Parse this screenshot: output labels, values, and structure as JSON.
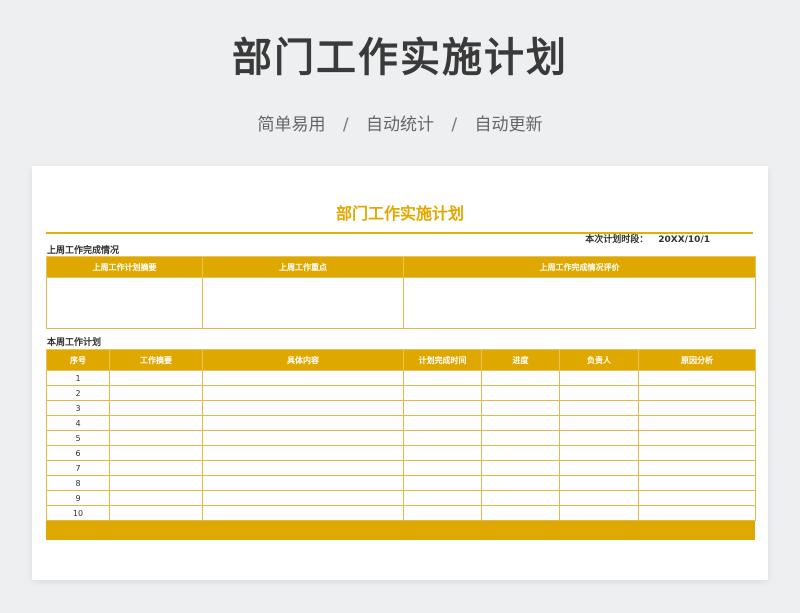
{
  "header": {
    "title": "部门工作实施计划",
    "subtitle_items": [
      "简单易用",
      "自动统计",
      "自动更新"
    ],
    "separator": "/"
  },
  "sheet": {
    "title": "部门工作实施计划",
    "plan_date_label": "本次计划时段：",
    "plan_date_value": "20XX/10/1",
    "last_week": {
      "section_label": "上周工作完成情况",
      "columns": [
        "上周工作计划摘要",
        "上周工作重点",
        "上周工作完成情况评价"
      ]
    },
    "this_week": {
      "section_label": "本周工作计划",
      "columns": [
        "序号",
        "工作摘要",
        "具体内容",
        "计划完成时间",
        "进度",
        "负责人",
        "原因分析"
      ],
      "rows": [
        "1",
        "2",
        "3",
        "4",
        "5",
        "6",
        "7",
        "8",
        "9",
        "10"
      ]
    }
  },
  "colors": {
    "accent": "#dfa800",
    "title_gold": "#e2a800",
    "background": "#eeeff1"
  }
}
